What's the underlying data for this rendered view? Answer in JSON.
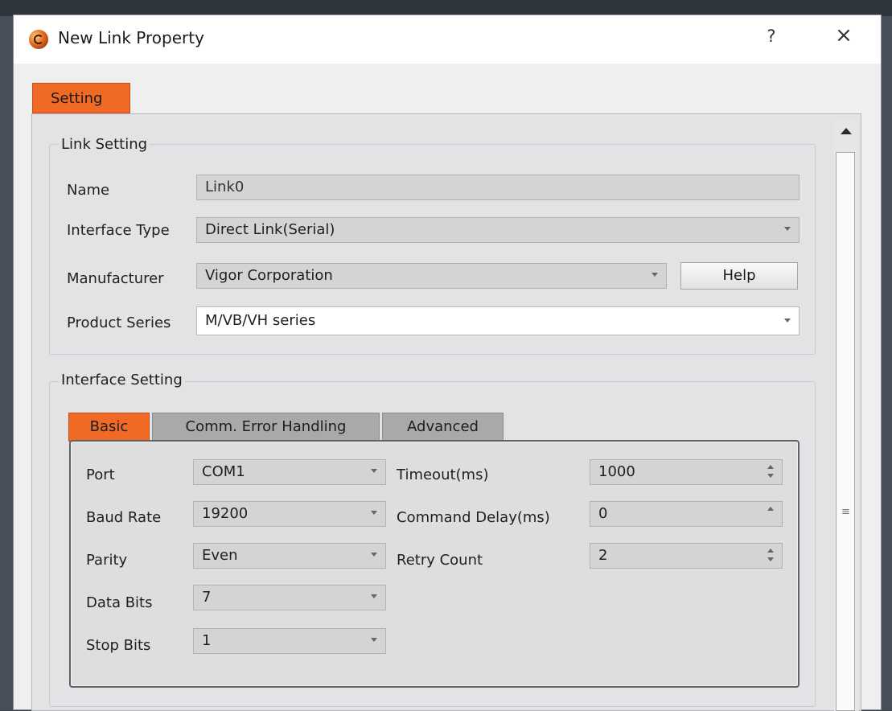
{
  "window": {
    "title": "New Link Property",
    "help_glyph": "?",
    "close_glyph": "×"
  },
  "main_tab": {
    "label": "Setting"
  },
  "link_setting": {
    "group_title": "Link Setting",
    "name": {
      "label": "Name",
      "value": "Link0"
    },
    "interface_type": {
      "label": "Interface Type",
      "value": "Direct Link(Serial)"
    },
    "manufacturer": {
      "label": "Manufacturer",
      "value": "Vigor Corporation"
    },
    "help_button": "Help",
    "product_series": {
      "label": "Product Series",
      "value": "M/VB/VH series"
    }
  },
  "interface_setting": {
    "group_title": "Interface Setting",
    "tabs": [
      "Basic",
      "Comm. Error Handling",
      "Advanced"
    ],
    "active_tab": "Basic",
    "left_fields": [
      {
        "label": "Port",
        "value": "COM1"
      },
      {
        "label": "Baud Rate",
        "value": "19200"
      },
      {
        "label": "Parity",
        "value": "Even"
      },
      {
        "label": "Data Bits",
        "value": "7"
      },
      {
        "label": "Stop Bits",
        "value": "1"
      }
    ],
    "right_fields": [
      {
        "label": "Timeout(ms)",
        "value": "1000"
      },
      {
        "label": "Command Delay(ms)",
        "value": "0"
      },
      {
        "label": "Retry Count",
        "value": "2"
      }
    ]
  },
  "scrollbar": {
    "grip_glyph": "≡"
  },
  "colors": {
    "accent": "#f06a25",
    "panel_bg": "#e3e3e5",
    "field_bg": "#d4d4d4"
  }
}
